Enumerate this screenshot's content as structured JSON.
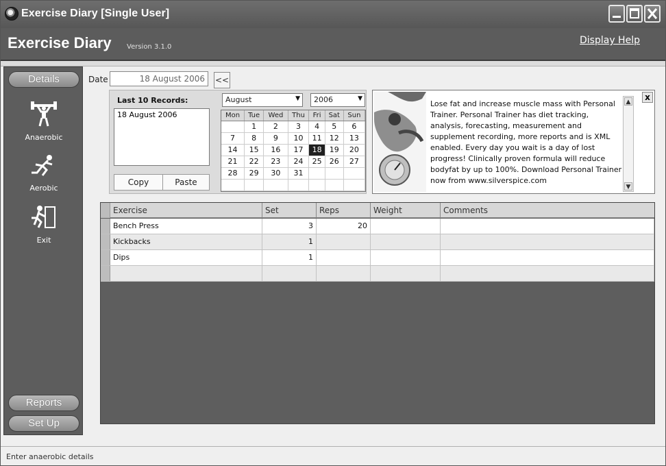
{
  "window": {
    "title": "Exercise Diary [Single User]"
  },
  "header": {
    "app_name": "Exercise Diary",
    "version": "Version 3.1.0",
    "help_link": "Display Help"
  },
  "sidebar": {
    "details": "Details",
    "items": [
      {
        "label": "Anaerobic",
        "icon": "weightlifter-icon"
      },
      {
        "label": "Aerobic",
        "icon": "runner-icon"
      },
      {
        "label": "Exit",
        "icon": "exit-runner-icon"
      }
    ],
    "reports": "Reports",
    "setup": "Set Up"
  },
  "date_bar": {
    "label": "Date",
    "value": "18 August 2006",
    "prev_button": "<<"
  },
  "records": {
    "title": "Last 10 Records:",
    "items": [
      "18 August 2006"
    ],
    "copy_button": "Copy",
    "paste_button": "Paste"
  },
  "calendar": {
    "month": "August",
    "year": "2006",
    "weekdays": [
      "Mon",
      "Tue",
      "Wed",
      "Thu",
      "Fri",
      "Sat",
      "Sun"
    ],
    "selected_day": 18,
    "weeks": [
      [
        "",
        "1",
        "2",
        "3",
        "4",
        "5",
        "6"
      ],
      [
        "7",
        "8",
        "9",
        "10",
        "11",
        "12",
        "13"
      ],
      [
        "14",
        "15",
        "16",
        "17",
        "18",
        "19",
        "20"
      ],
      [
        "21",
        "22",
        "23",
        "24",
        "25",
        "26",
        "27"
      ],
      [
        "28",
        "29",
        "30",
        "31",
        "",
        "",
        ""
      ],
      [
        "",
        "",
        "",
        "",
        "",
        "",
        ""
      ]
    ]
  },
  "ad": {
    "text": "Lose fat and increase muscle mass with Personal Trainer. Personal Trainer has diet tracking, analysis, forecasting, measurement and supplement recording, more reports and is XML enabled. Every day you wait is a day of lost progress! Clinically proven formula will reduce bodyfat by up to 100%. Download Personal Trainer now from www.silverspice.com",
    "close": "x"
  },
  "grid": {
    "columns": [
      "Exercise",
      "Set",
      "Reps",
      "Weight",
      "Comments"
    ],
    "rows": [
      {
        "exercise": "Bench Press",
        "set": "3",
        "reps": "20",
        "weight": "",
        "comments": ""
      },
      {
        "exercise": "Kickbacks",
        "set": "1",
        "reps": "",
        "weight": "",
        "comments": ""
      },
      {
        "exercise": "Dips",
        "set": "1",
        "reps": "",
        "weight": "",
        "comments": ""
      },
      {
        "exercise": "",
        "set": "",
        "reps": "",
        "weight": "",
        "comments": ""
      }
    ]
  },
  "status": {
    "text": "Enter anaerobic details"
  }
}
